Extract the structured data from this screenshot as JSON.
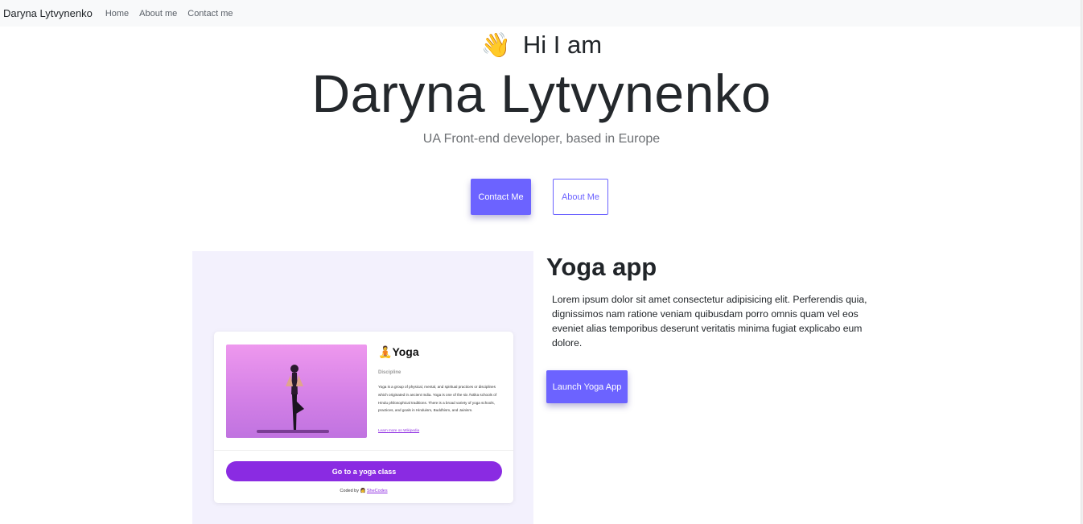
{
  "navbar": {
    "brand": "Daryna Lytvynenko",
    "links": [
      "Home",
      "About me",
      "Contact me"
    ]
  },
  "hero": {
    "wave_emoji": "👋",
    "greeting": "Hi I am",
    "name": "Daryna Lytvynenko",
    "tagline": "UA Front-end developer, based in Europe",
    "contact_label": "Contact Me",
    "about_label": "About Me"
  },
  "project": {
    "title": "Yoga app",
    "description": "Lorem ipsum dolor sit amet consectetur adipisicing elit. Perferendis quia, dignissimos nam ratione veniam quibusdam porro omnis quam vel eos eveniet alias temporibus deserunt veritatis minima fugiat explicabo eum dolore.",
    "launch_label": "Launch Yoga App",
    "preview": {
      "emoji": "🧘",
      "title": "Yoga",
      "subtitle": "Discipline",
      "description": "Yoga is a group of physical, mental, and spiritual practices or disciplines which originated in ancient India. Yoga is one of the six Āstika schools of Hindu philosophical traditions. There is a broad variety of yoga schools, practices, and goals in Hinduism, Buddhism, and Jainism.",
      "link": "Learn more on Wikipedia",
      "cta": "Go to a yoga class",
      "coded_by": "Coded by",
      "coded_emoji": "👩",
      "coded_link": "SheCodes"
    }
  },
  "colors": {
    "accent": "#6c63ff",
    "yoga_purple": "#8a2be2",
    "preview_bg": "#f3f1fd"
  }
}
